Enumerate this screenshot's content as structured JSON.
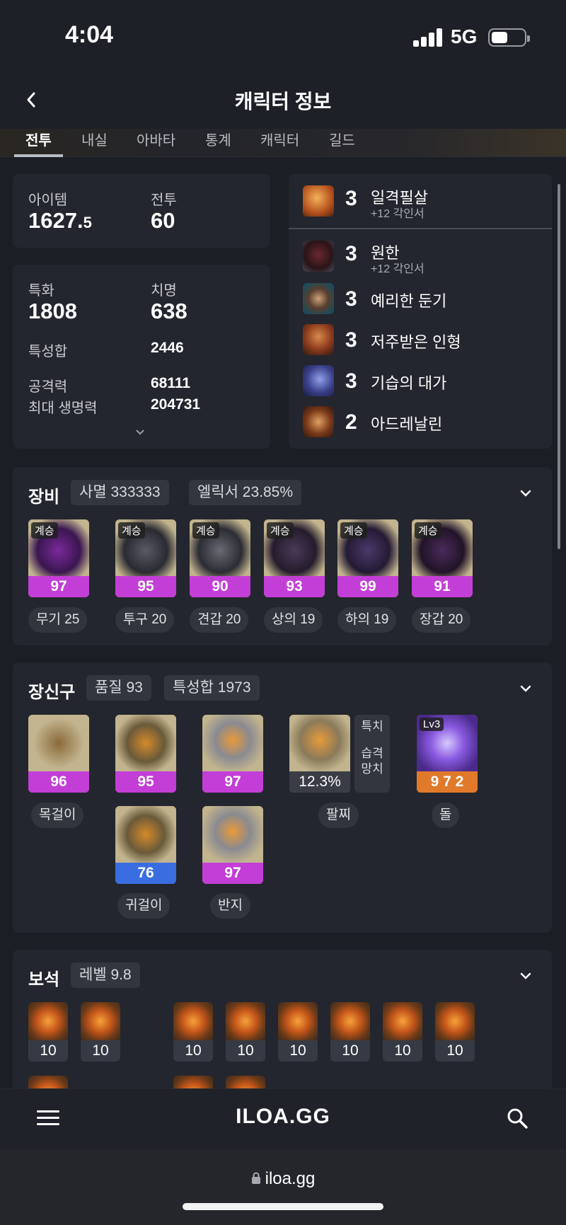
{
  "status": {
    "time": "4:04",
    "network": "5G"
  },
  "header": {
    "title": "캐릭터 정보"
  },
  "tabs": [
    "전투",
    "내실",
    "아바타",
    "통계",
    "캐릭터",
    "길드"
  ],
  "summary": {
    "item_label": "아이템",
    "item_value_main": "1627.",
    "item_value_dec": "5",
    "battle_label": "전투",
    "battle_value": "60"
  },
  "stats": {
    "spec_label": "특화",
    "spec_value": "1808",
    "crit_label": "치명",
    "crit_value": "638",
    "sum_label": "특성합",
    "sum_value": "2446",
    "atk_label": "공격력",
    "atk_value": "68111",
    "hp_label": "최대 생명력",
    "hp_value": "204731"
  },
  "engravings": [
    {
      "level": "3",
      "name": "일격필살",
      "sub": "+12 각인서"
    },
    {
      "level": "3",
      "name": "원한",
      "sub": "+12 각인서"
    },
    {
      "level": "3",
      "name": "예리한 둔기",
      "sub": ""
    },
    {
      "level": "3",
      "name": "저주받은 인형",
      "sub": ""
    },
    {
      "level": "3",
      "name": "기습의 대가",
      "sub": ""
    },
    {
      "level": "2",
      "name": "아드레날린",
      "sub": ""
    }
  ],
  "equipment": {
    "title": "장비",
    "chip1": "사멸 333333",
    "chip2": "엘릭서 23.85%",
    "items": [
      {
        "tag": "계승",
        "quality": "97",
        "label": "무기 25"
      },
      {
        "tag": "계승",
        "quality": "95",
        "label": "투구 20"
      },
      {
        "tag": "계승",
        "quality": "90",
        "label": "견갑 20"
      },
      {
        "tag": "계승",
        "quality": "93",
        "label": "상의 19"
      },
      {
        "tag": "계승",
        "quality": "99",
        "label": "하의 19"
      },
      {
        "tag": "계승",
        "quality": "91",
        "label": "장갑 20"
      }
    ]
  },
  "accessories": {
    "title": "장신구",
    "chip1": "품질 93",
    "chip2": "특성합 1973",
    "necklace": {
      "quality": "96",
      "label": "목걸이"
    },
    "earring1": {
      "quality": "95"
    },
    "earring2": {
      "quality": "76"
    },
    "earring_label": "귀걸이",
    "ring1": {
      "quality": "97"
    },
    "ring2": {
      "quality": "97"
    },
    "ring_label": "반지",
    "bracelet": {
      "value": "12.3%",
      "label": "팔찌",
      "side_top": "특치",
      "side_bottom": "습격\n망치"
    },
    "stone": {
      "tag": "Lv3",
      "value": "9 7 2",
      "label": "돌"
    }
  },
  "gems": {
    "title": "보석",
    "chip": "레벨 9.8",
    "levels": [
      "10",
      "10",
      "10",
      "10",
      "10",
      "10",
      "10",
      "10"
    ]
  },
  "bottom": {
    "logo": "ILOA.GG"
  },
  "url": "iloa.gg"
}
